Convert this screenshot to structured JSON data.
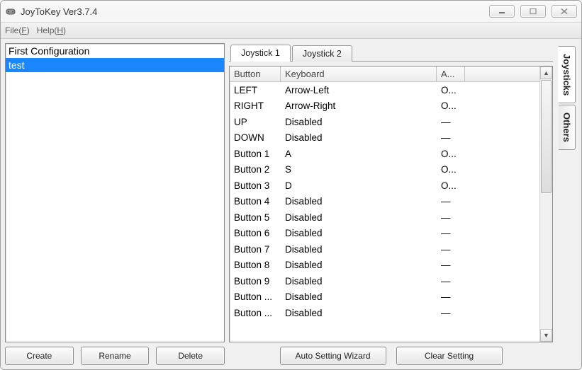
{
  "window": {
    "title": "JoyToKey Ver3.7.4"
  },
  "menubar": {
    "file": "File(F)",
    "help": "Help(H)"
  },
  "config_list": {
    "items": [
      {
        "name": "First Configuration",
        "selected": false
      },
      {
        "name": "test",
        "selected": true
      }
    ]
  },
  "left_buttons": {
    "create": "Create",
    "rename": "Rename",
    "delete": "Delete"
  },
  "tabs": {
    "joystick1": "Joystick 1",
    "joystick2": "Joystick 2"
  },
  "columns": {
    "button": "Button",
    "keyboard": "Keyboard",
    "a": "A..."
  },
  "rows": [
    {
      "button": "LEFT",
      "keyboard": "Arrow-Left",
      "a": "O..."
    },
    {
      "button": "RIGHT",
      "keyboard": "Arrow-Right",
      "a": "O..."
    },
    {
      "button": "UP",
      "keyboard": "Disabled",
      "a": "—"
    },
    {
      "button": "DOWN",
      "keyboard": "Disabled",
      "a": "—"
    },
    {
      "button": "Button 1",
      "keyboard": "A",
      "a": "O..."
    },
    {
      "button": "Button 2",
      "keyboard": "S",
      "a": "O..."
    },
    {
      "button": "Button 3",
      "keyboard": "D",
      "a": "O..."
    },
    {
      "button": "Button 4",
      "keyboard": "Disabled",
      "a": "—"
    },
    {
      "button": "Button 5",
      "keyboard": "Disabled",
      "a": "—"
    },
    {
      "button": "Button 6",
      "keyboard": "Disabled",
      "a": "—"
    },
    {
      "button": "Button 7",
      "keyboard": "Disabled",
      "a": "—"
    },
    {
      "button": "Button 8",
      "keyboard": "Disabled",
      "a": "—"
    },
    {
      "button": "Button 9",
      "keyboard": "Disabled",
      "a": "—"
    },
    {
      "button": "Button ...",
      "keyboard": "Disabled",
      "a": "—"
    },
    {
      "button": "Button ...",
      "keyboard": "Disabled",
      "a": "—"
    }
  ],
  "action_buttons": {
    "auto": "Auto Setting Wizard",
    "clear": "Clear Setting"
  },
  "vtabs": {
    "joysticks": "Joysticks",
    "others": "Others"
  }
}
